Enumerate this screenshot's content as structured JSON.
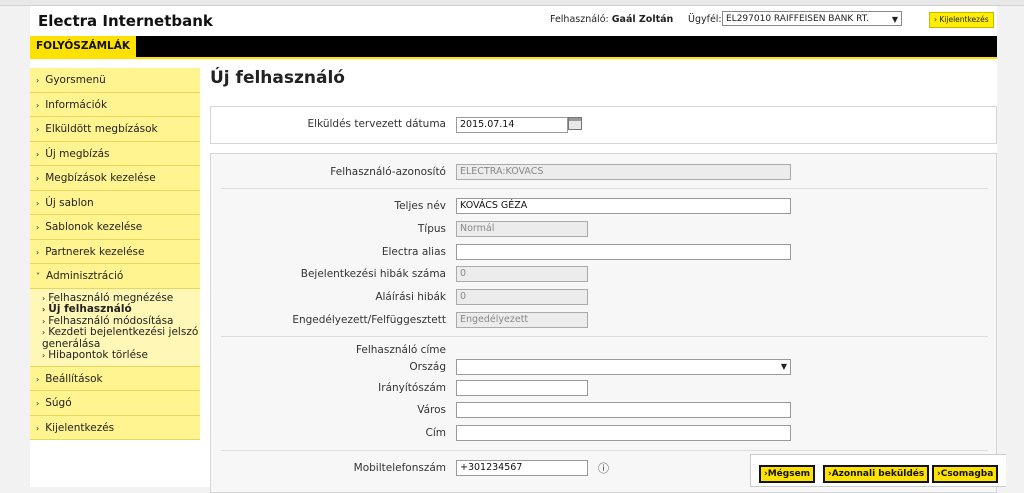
{
  "header": {
    "brand": "Electra Internetbank",
    "user_label": "Felhasználó:",
    "user_name": "Gaál Zoltán",
    "client_label": "Ügyfél:",
    "client_value": "EL297010 RAIFFEISEN BANK RT.",
    "logout_label": "Kijelentkezés"
  },
  "menubar": {
    "active_tab": "FOLYÓSZÁMLÁK"
  },
  "sidebar": {
    "items": [
      {
        "label": "Gyorsmenü"
      },
      {
        "label": "Információk"
      },
      {
        "label": "Elküldött megbízások"
      },
      {
        "label": "Új megbízás"
      },
      {
        "label": "Megbízások kezelése"
      },
      {
        "label": "Új sablon"
      },
      {
        "label": "Sablonok kezelése"
      },
      {
        "label": "Partnerek kezelése"
      },
      {
        "label": "Adminisztráció"
      }
    ],
    "sub_items": [
      {
        "label": "Felhasználó megnézése"
      },
      {
        "label": "Új felhasználó"
      },
      {
        "label": "Felhasználó módosítása"
      },
      {
        "label": "Kezdeti bejelentkezési jelszó generálása"
      },
      {
        "label": "Hibapontok törlése"
      }
    ],
    "bottom_items": [
      {
        "label": "Beállítások"
      },
      {
        "label": "Súgó"
      },
      {
        "label": "Kijelentkezés"
      }
    ]
  },
  "main": {
    "title": "Új felhasználó",
    "send_date_label": "Elküldés tervezett dátuma",
    "send_date_value": "2015.07.14",
    "fields": {
      "user_id_label": "Felhasználó-azonosító",
      "user_id_value": "ELECTRA:KOVACS",
      "full_name_label": "Teljes név",
      "full_name_value": "KOVÁCS GÉZA",
      "type_label": "Típus",
      "type_value": "Normál",
      "alias_label": "Electra alias",
      "alias_value": "",
      "login_errors_label": "Bejelentkezési hibák száma",
      "login_errors_value": "0",
      "sign_errors_label": "Aláírási hibák",
      "sign_errors_value": "0",
      "status_label": "Engedélyezett/Felfüggesztett",
      "status_value": "Engedélyezett",
      "address_heading": "Felhasználó címe",
      "country_label": "Ország",
      "country_value": "",
      "zip_label": "Irányítószám",
      "zip_value": "",
      "city_label": "Város",
      "city_value": "",
      "street_label": "Cím",
      "street_value": "",
      "mobile_label": "Mobiltelefonszám",
      "mobile_value": "+301234567"
    }
  },
  "actions": {
    "cancel": "Mégsem",
    "send_now": "Azonnali beküldés",
    "batch": "Csomagba"
  }
}
